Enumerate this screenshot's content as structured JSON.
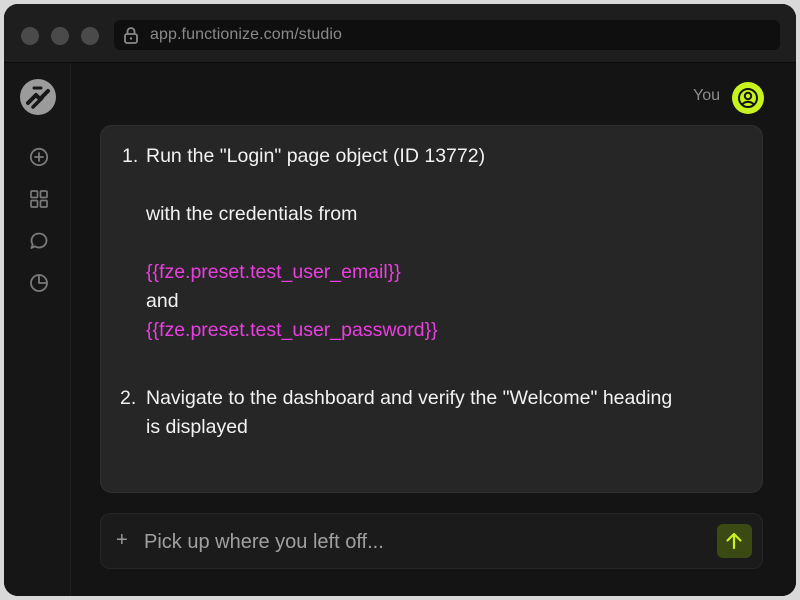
{
  "browser": {
    "url": "app.functionize.com/studio"
  },
  "sidebar": {
    "items": [
      {
        "icon": "plus-circle-icon"
      },
      {
        "icon": "grid-icon"
      },
      {
        "icon": "chat-icon"
      },
      {
        "icon": "pie-chart-icon"
      }
    ]
  },
  "chat": {
    "sender_label": "You",
    "message": {
      "step1_number": "1.",
      "step1_line1": "Run the \"Login\" page object (ID 13772)",
      "step1_line2": "with the credentials from",
      "step1_email_var": "{{fze.preset.test_user_email}}",
      "step1_and": "and",
      "step1_password_var": "{{fze.preset.test_user_password}}",
      "step2_number": "2.",
      "step2_line1": "Navigate to the dashboard and verify the \"Welcome\" heading",
      "step2_line2": "is displayed"
    }
  },
  "composer": {
    "plus": "+",
    "placeholder": "Pick up where you left off...",
    "send_icon": "arrow-up-icon"
  },
  "colors": {
    "accent": "#c8f31d",
    "variable": "#ea3fe0",
    "send_bg": "#3a4a12"
  }
}
